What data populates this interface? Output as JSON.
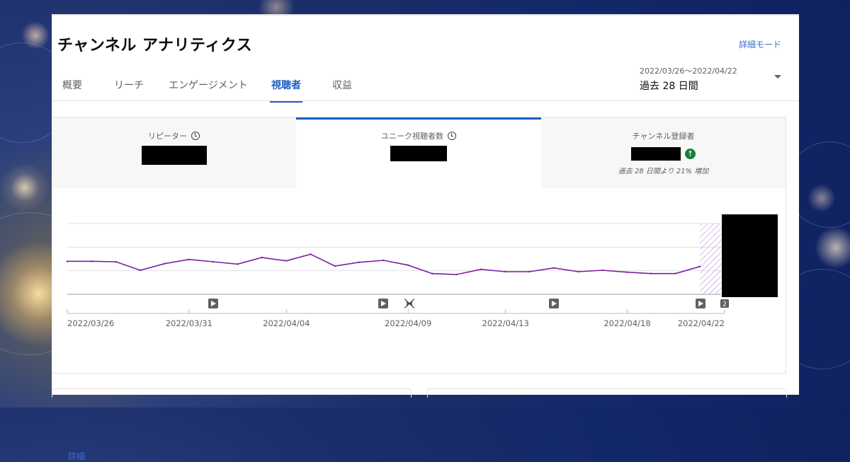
{
  "header": {
    "title": "チャンネル アナリティクス",
    "advanced_mode": "詳細モード"
  },
  "tabs": [
    {
      "label": "概要",
      "active": false
    },
    {
      "label": "リーチ",
      "active": false
    },
    {
      "label": "エンゲージメント",
      "active": false
    },
    {
      "label": "視聴者",
      "active": true
    },
    {
      "label": "収益",
      "active": false
    }
  ],
  "date_selector": {
    "range": "2022/03/26〜2022/04/22",
    "period": "過去 28 日間"
  },
  "metrics": [
    {
      "label": "リピーター",
      "value": "",
      "value_redacted": true,
      "icon": "clock-icon"
    },
    {
      "label": "ユニーク視聴者数",
      "value": "",
      "value_redacted": true,
      "icon": "clock-icon",
      "active": true
    },
    {
      "label": "チャンネル登録者",
      "value": "",
      "value_redacted": true,
      "trend_icon": "arrow-up-icon",
      "change": "過去 28 日間より 21% 増加"
    }
  ],
  "detail_link": "詳細",
  "chart_data": {
    "type": "line",
    "x_tick_labels": [
      "2022/03/26",
      "2022/03/31",
      "2022/04/04",
      "2022/04/09",
      "2022/04/13",
      "2022/04/18",
      "2022/04/22"
    ],
    "series": [
      {
        "color": "#7b1fa2",
        "values": [
          0.7,
          0.7,
          0.69,
          0.51,
          0.65,
          0.74,
          0.69,
          0.64,
          0.78,
          0.71,
          0.85,
          0.6,
          0.68,
          0.72,
          0.62,
          0.44,
          0.42,
          0.53,
          0.48,
          0.48,
          0.56,
          0.48,
          0.51,
          0.47,
          0.44,
          0.44,
          0.59
        ]
      }
    ],
    "ylim": [
      0,
      1.5
    ],
    "grid": true,
    "value_axis_redacted": true,
    "hatched_region": "last day (incomplete data)",
    "timeline_markers": [
      {
        "type": "video-icon",
        "label": ""
      },
      {
        "type": "video-icon",
        "label": ""
      },
      {
        "type": "live-icon",
        "label": ""
      },
      {
        "type": "video-icon",
        "label": ""
      },
      {
        "type": "video-icon",
        "label": ""
      },
      {
        "type": "count-badge",
        "label": "2"
      }
    ]
  },
  "colors": {
    "accent": "#1b5fc4",
    "link": "#3e6ec5",
    "positive": "#188038",
    "series": "#7b1fa2"
  }
}
